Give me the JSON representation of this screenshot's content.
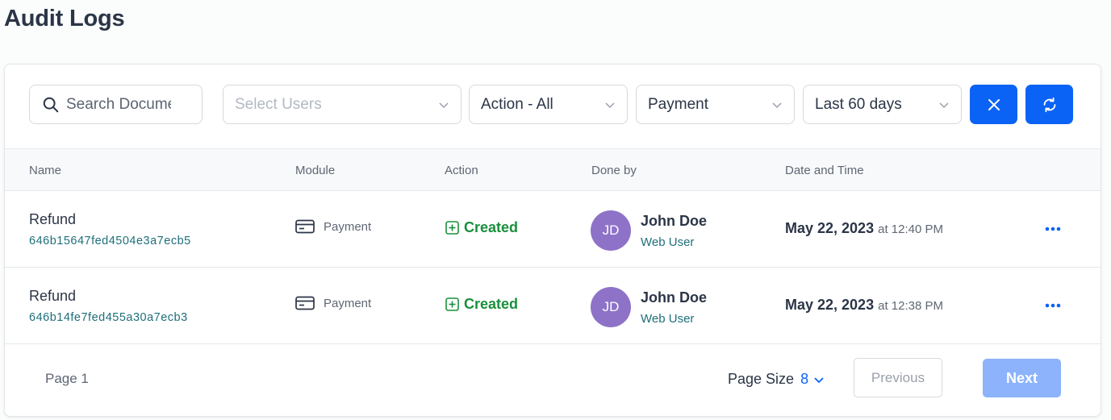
{
  "page": {
    "title": "Audit Logs"
  },
  "filters": {
    "search_placeholder": "Search Documents",
    "users_placeholder": "Select Users",
    "action_value": "Action - All",
    "module_value": "Payment",
    "date_range_value": "Last 60 days",
    "clear_icon": "close-icon",
    "refresh_icon": "refresh-icon"
  },
  "table": {
    "columns": [
      "Name",
      "Module",
      "Action",
      "Done by",
      "Date and Time"
    ],
    "rows": [
      {
        "name": "Refund",
        "id": "646b15647fed4504e3a7ecb5",
        "module": "Payment",
        "action": "Created",
        "user_initials": "JD",
        "user_name": "John Doe",
        "user_role": "Web User",
        "date": "May 22, 2023",
        "time": "at 12:40 PM"
      },
      {
        "name": "Refund",
        "id": "646b14fe7fed455a30a7ecb3",
        "module": "Payment",
        "action": "Created",
        "user_initials": "JD",
        "user_name": "John Doe",
        "user_role": "Web User",
        "date": "May 22, 2023",
        "time": "at 12:38 PM"
      }
    ]
  },
  "footer": {
    "page_label": "Page 1",
    "page_size_label": "Page Size",
    "page_size_value": "8",
    "previous_label": "Previous",
    "next_label": "Next"
  },
  "colors": {
    "accent": "#0b63f6",
    "next_disabled": "#8cb3fb",
    "created_green": "#1a8f3c",
    "avatar": "#8e72c8"
  }
}
